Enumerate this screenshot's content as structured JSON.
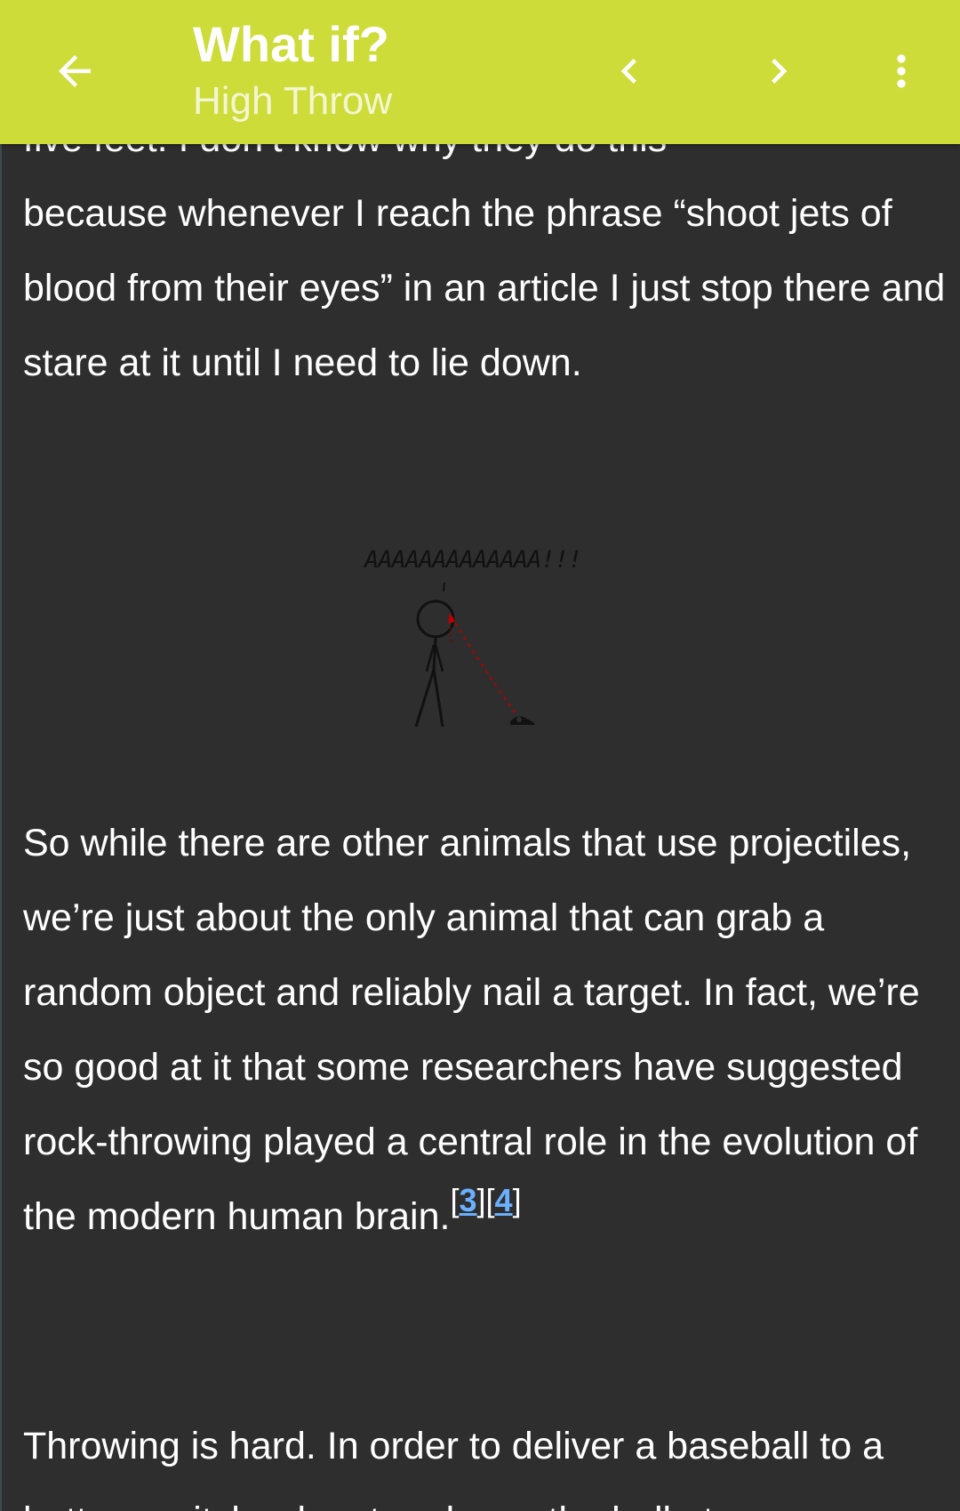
{
  "app_bar": {
    "title": "What if?",
    "subtitle": "High Throw",
    "back_icon": "arrow-left-icon",
    "prev_icon": "chevron-left-icon",
    "next_icon": "chevron-right-icon",
    "menu_icon": "more-vertical-icon",
    "color": "#cddc39"
  },
  "article": {
    "para1_top": "five feet. I don’t know why they do this",
    "para1_rest": "because whenever I reach the phrase “shoot jets of blood from their eyes” in an article I just stop there and stare at it until I need to lie down.",
    "comic_caption": "AAAAAAAAAAAAA!!!",
    "para2": "So while there are other animals that use projectiles, we’re just about the only animal that can grab a random object and reliably nail a target. In fact, we’re so good at it that some researchers have suggested rock-throwing played a central role in the evolution of the modern human brain.",
    "citations": [
      "3",
      "4"
    ],
    "para3": "Throwing is hard. In order to deliver a baseball to a batter, a pitcher has to release the ball at"
  },
  "colors": {
    "background": "#2e2e2e",
    "text": "#ffffff",
    "link": "#6ab0ff"
  }
}
